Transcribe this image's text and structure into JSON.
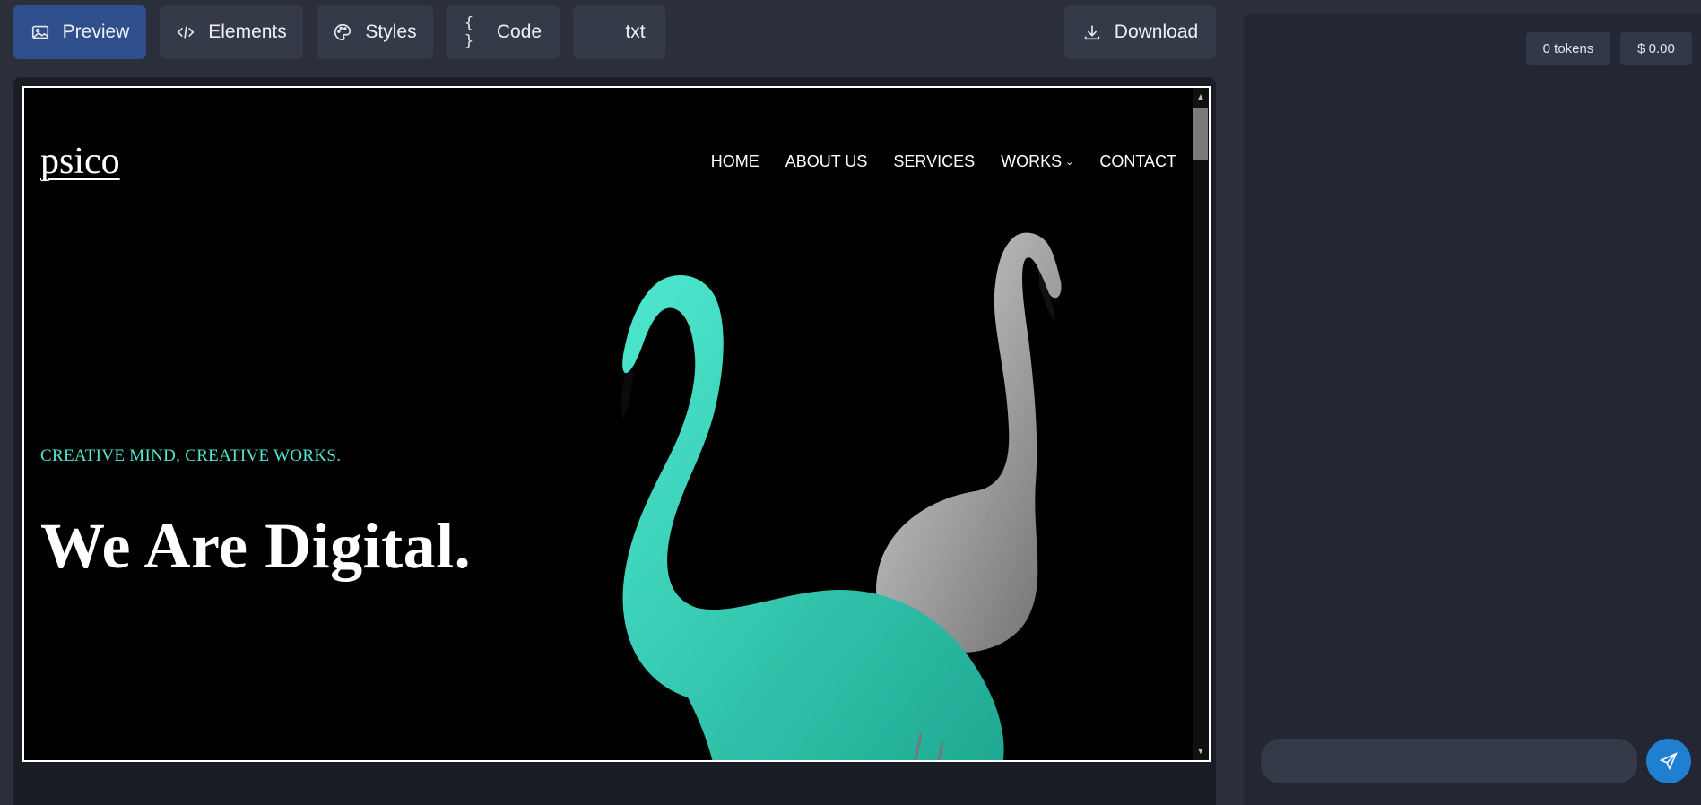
{
  "toolbar": {
    "preview_label": "Preview",
    "elements_label": "Elements",
    "styles_label": "Styles",
    "code_label": "Code",
    "txt_label": "txt",
    "download_label": "Download"
  },
  "site": {
    "logo": "psico",
    "nav": {
      "home": "HOME",
      "about": "ABOUT US",
      "services": "SERVICES",
      "works": "WORKS",
      "contact": "CONTACT"
    },
    "tagline": "CREATIVE MIND, CREATIVE WORKS.",
    "headline": "We Are Digital."
  },
  "panel": {
    "tokens": "0 tokens",
    "cost": "$ 0.00",
    "chat_placeholder": ""
  },
  "colors": {
    "accent": "#2f4f8c",
    "teal": "#52e6d3",
    "send": "#1f7fd0"
  }
}
